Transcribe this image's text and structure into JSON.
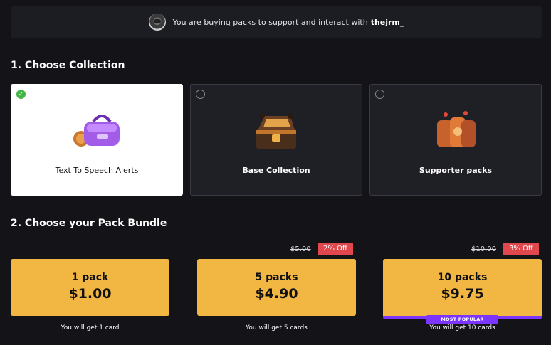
{
  "banner": {
    "text": "You are buying packs to support and interact with",
    "creator": "thejrm_"
  },
  "section1": {
    "title": "1. Choose Collection"
  },
  "collections": [
    {
      "label": "Text To Speech Alerts",
      "selected": true,
      "icon": "duffel-bag-icon"
    },
    {
      "label": "Base Collection",
      "selected": false,
      "icon": "treasure-chest-icon"
    },
    {
      "label": "Supporter packs",
      "selected": false,
      "icon": "card-packs-icon"
    }
  ],
  "section2": {
    "title": "2. Choose your Pack Bundle"
  },
  "bundles": [
    {
      "count": "1 pack",
      "price": "$1.00",
      "note": "You will get 1 card"
    },
    {
      "count": "5 packs",
      "price": "$4.90",
      "old_price": "$5.00",
      "discount": "2% Off",
      "note": "You will get 5 cards"
    },
    {
      "count": "10 packs",
      "price": "$9.75",
      "old_price": "$10.00",
      "discount": "3% Off",
      "note": "You will get 10 cards",
      "tag": "MOST POPULAR"
    }
  ],
  "colors": {
    "accent": "#f2b642",
    "popular": "#7b35ff",
    "discount": "#e0484d",
    "selected_check": "#45b549"
  }
}
